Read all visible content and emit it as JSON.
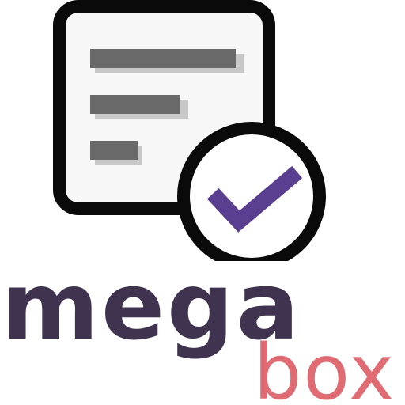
{
  "logo": {
    "word_primary": "mega",
    "word_secondary": "box",
    "colors": {
      "primary": "#3f3350",
      "secondary": "#e06b72",
      "outline": "#0a0a0a",
      "card_fill": "#f7f7f7",
      "bars": "#696969",
      "bar_shadow": "#c8c8c8",
      "check": "#5a3f90"
    },
    "icons": [
      "document-icon",
      "checkmark-icon"
    ]
  }
}
